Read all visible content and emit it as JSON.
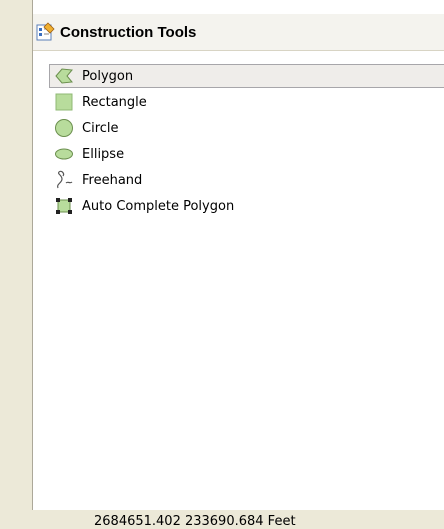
{
  "panel": {
    "title": "Construction Tools",
    "icon": "construction-tools-icon"
  },
  "tools": [
    {
      "label": "Polygon",
      "icon": "polygon-icon",
      "selected": true
    },
    {
      "label": "Rectangle",
      "icon": "rectangle-icon",
      "selected": false
    },
    {
      "label": "Circle",
      "icon": "circle-icon",
      "selected": false
    },
    {
      "label": "Ellipse",
      "icon": "ellipse-icon",
      "selected": false
    },
    {
      "label": "Freehand",
      "icon": "freehand-icon",
      "selected": false
    },
    {
      "label": "Auto Complete Polygon",
      "icon": "auto-complete-polygon-icon",
      "selected": false
    }
  ],
  "status": {
    "coordinates": "2684651.402  233690.684 Feet"
  },
  "colors": {
    "shape_fill": "#b8dc9c",
    "shape_stroke": "#6b8f4e",
    "selection_bg": "#efedea"
  }
}
